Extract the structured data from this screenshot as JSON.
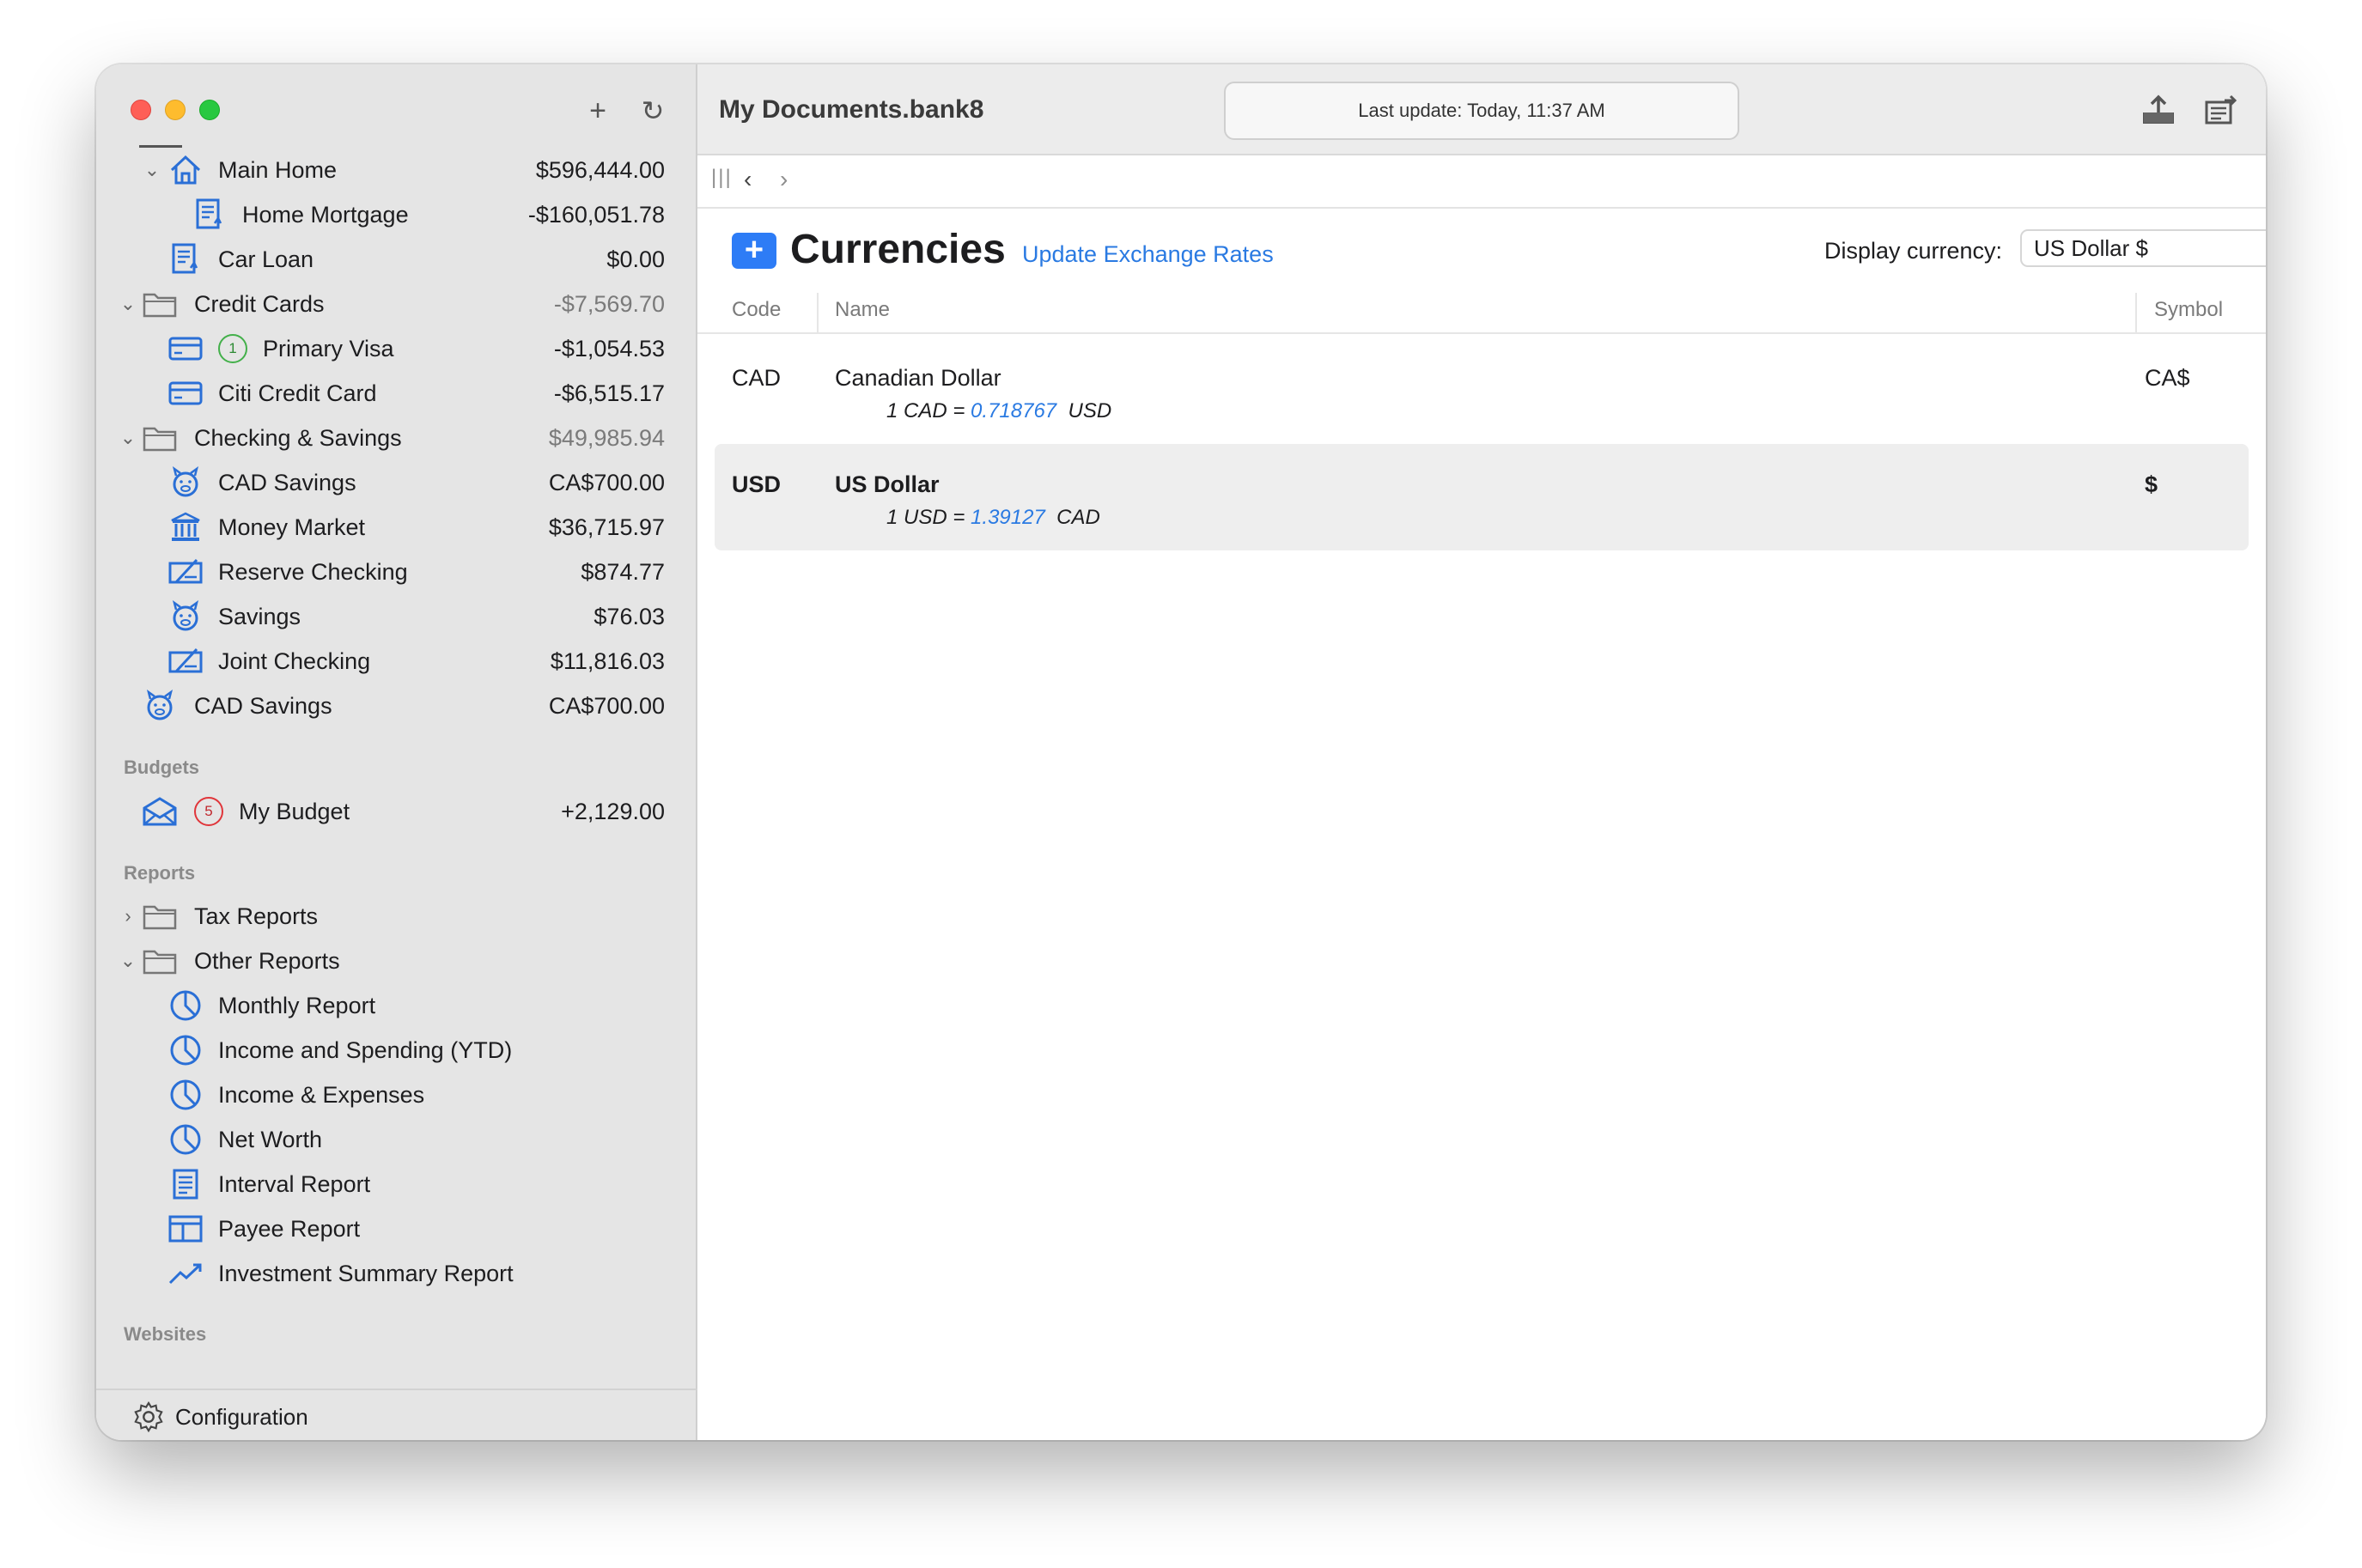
{
  "sidebar": {
    "rows": [
      {
        "label": "Main Home",
        "amount": "$596,444.00",
        "muted": false
      },
      {
        "label": "Home Mortgage",
        "amount": "-$160,051.78",
        "muted": false
      },
      {
        "label": "Car Loan",
        "amount": "$0.00",
        "muted": false
      },
      {
        "label": "Credit Cards",
        "amount": "-$7,569.70",
        "muted": true
      },
      {
        "label": "Primary Visa",
        "amount": "-$1,054.53",
        "muted": false,
        "badge": "1"
      },
      {
        "label": "Citi Credit Card",
        "amount": "-$6,515.17",
        "muted": false
      },
      {
        "label": "Checking & Savings",
        "amount": "$49,985.94",
        "muted": true
      },
      {
        "label": "CAD Savings",
        "amount": "CA$700.00",
        "muted": false
      },
      {
        "label": "Money Market",
        "amount": "$36,715.97",
        "muted": false
      },
      {
        "label": "Reserve Checking",
        "amount": "$874.77",
        "muted": false
      },
      {
        "label": "Savings",
        "amount": "$76.03",
        "muted": false
      },
      {
        "label": "Joint Checking",
        "amount": "$11,816.03",
        "muted": false
      },
      {
        "label": "CAD Savings",
        "amount": "CA$700.00",
        "muted": false
      }
    ],
    "budgets_heading": "Budgets",
    "budget": {
      "label": "My Budget",
      "amount": "+2,129.00",
      "badge": "5"
    },
    "reports_heading": "Reports",
    "reports": [
      {
        "label": "Tax Reports"
      },
      {
        "label": "Other Reports"
      },
      {
        "label": "Monthly Report"
      },
      {
        "label": "Income and Spending (YTD)"
      },
      {
        "label": "Income & Expenses"
      },
      {
        "label": "Net Worth"
      },
      {
        "label": "Interval Report"
      },
      {
        "label": "Payee Report"
      },
      {
        "label": "Investment Summary Report"
      }
    ],
    "websites_heading": "Websites",
    "footer_label": "Configuration"
  },
  "header": {
    "document_title": "My Documents.bank8",
    "status": "Last update: Today, 11:37 AM"
  },
  "page": {
    "title": "Currencies",
    "update_link": "Update Exchange Rates",
    "display_label": "Display currency:",
    "display_value": "US Dollar $"
  },
  "table": {
    "columns": [
      "Code",
      "Name",
      "Symbol"
    ],
    "rows": [
      {
        "code": "CAD",
        "name": "Canadian Dollar",
        "rate_prefix": "1 CAD = ",
        "rate_value": "0.718767",
        "rate_suffix": "  USD",
        "symbol": "CA$"
      },
      {
        "code": "USD",
        "name": "US Dollar",
        "rate_prefix": "1 USD = ",
        "rate_value": "1.39127",
        "rate_suffix": "  CAD",
        "symbol": "$"
      }
    ]
  },
  "colors": {
    "accent": "#2d7cf6",
    "link": "#2a7ae2",
    "sidebar": "#e5e5e5"
  }
}
